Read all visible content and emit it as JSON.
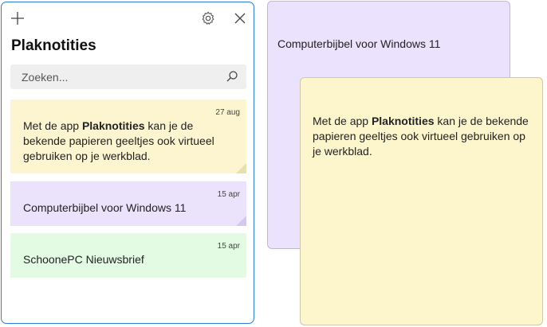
{
  "app": {
    "title": "Plaknotities",
    "toolbar": {
      "new_note_icon": "plus-icon",
      "settings_icon": "gear-icon",
      "close_icon": "close-icon"
    },
    "search": {
      "placeholder": "Zoeken...",
      "icon": "search-icon"
    },
    "notes": [
      {
        "date": "27 aug",
        "text_before": "Met de app ",
        "text_bold": "Plaknotities",
        "text_after": " kan je de bekende papieren geeltjes ook virtueel gebruiken op je werkblad.",
        "color": "#fdf5cf",
        "fold_color": "#e9dfae"
      },
      {
        "date": "15 apr",
        "text": "Computerbijbel voor Windows 11",
        "color": "#ebe3fb",
        "fold_color": "#d3c8ee"
      },
      {
        "date": "15 apr",
        "text": "SchoonePC Nieuwsbrief",
        "color": "#e3fbe3"
      }
    ]
  },
  "open_notes": {
    "purple": {
      "text": "Computerbijbel voor Windows 11",
      "color": "#ebe3fd"
    },
    "yellow": {
      "text_before": "Met de app ",
      "text_bold": "Plaknotities",
      "text_after": " kan je de bekende papieren geeltjes ook virtueel gebruiken op je werkblad.",
      "color": "#fdf5cc"
    }
  }
}
